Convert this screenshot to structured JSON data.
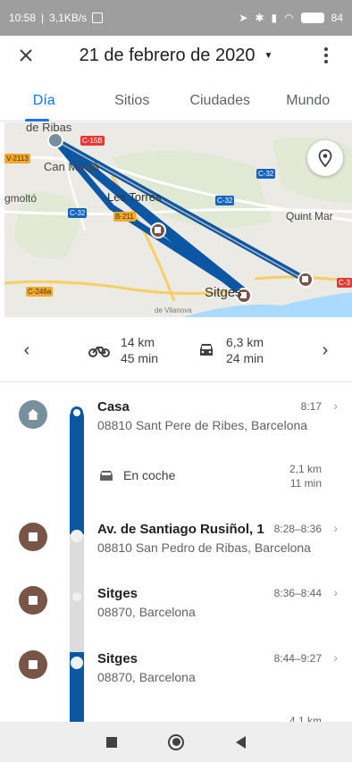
{
  "status_bar": {
    "time": "10:58",
    "speed": "3,1KB/s",
    "battery": "84"
  },
  "header": {
    "close_icon": "close-icon",
    "title": "21 de febrero de 2020",
    "menu_icon": "more-vert-icon"
  },
  "tabs": [
    {
      "label": "Día",
      "active": true
    },
    {
      "label": "Sitios",
      "active": false
    },
    {
      "label": "Ciudades",
      "active": false
    },
    {
      "label": "Mundo",
      "active": false
    }
  ],
  "map": {
    "labels": {
      "ribas": "de Ribas",
      "can_macia": "Can Macià",
      "gmolto": "gmoltó",
      "les_torres": "Les Torres",
      "quint_mar": "Quint Mar",
      "sitges": "Sitges",
      "vilanova": "de Vilanova"
    },
    "road_badges": {
      "c15b": "C-15B",
      "v2113": "V-2113",
      "c32a": "C-32",
      "b211": "B-211",
      "c32b": "C-32",
      "c32c": "C-32",
      "c246a": "C-246a",
      "c3": "C-3"
    },
    "route_color": "#0b57a4"
  },
  "summary": {
    "prev_label": "‹",
    "next_label": "›",
    "bike": {
      "distance": "14 km",
      "duration": "45 min"
    },
    "car": {
      "distance": "6,3 km",
      "duration": "24 min"
    }
  },
  "timeline": {
    "entries": [
      {
        "title": "Casa",
        "address": "08810 Sant Pere de Ribes, Barcelona",
        "time": "8:17"
      },
      {
        "mode": "En coche",
        "distance": "2,1 km",
        "duration": "11 min"
      },
      {
        "title": "Av. de Santiago Rusiñol, 1",
        "address": "08810 San Pedro de Ribas, Barcelona",
        "time": "8:28–8:36"
      },
      {
        "title": "Sitges",
        "address": "08870, Barcelona",
        "time": "8:36–8:44"
      },
      {
        "title": "Sitges",
        "address": "08870, Barcelona",
        "time": "8:44–9:27"
      },
      {
        "distance": "4,1 km"
      }
    ]
  },
  "colors": {
    "accent": "#1a73e8",
    "route": "#0b57a4",
    "place_brown": "#795548",
    "home_gray": "#78909c"
  }
}
